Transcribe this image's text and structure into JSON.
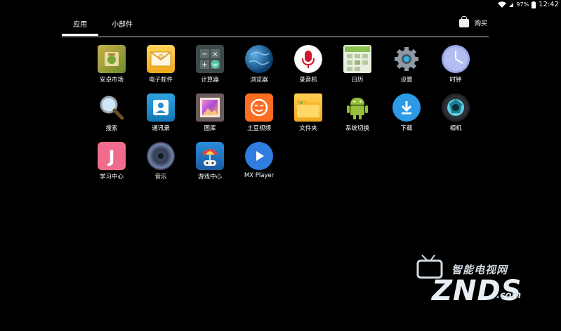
{
  "status": {
    "battery": "97%",
    "time": "12:42"
  },
  "tabs": {
    "apps": "应用",
    "widgets": "小部件",
    "buy": "购买"
  },
  "apps": [
    {
      "label": "安卓市场",
      "icon": "market-icon"
    },
    {
      "label": "电子邮件",
      "icon": "email-icon"
    },
    {
      "label": "计算器",
      "icon": "calculator-icon"
    },
    {
      "label": "浏览器",
      "icon": "browser-icon"
    },
    {
      "label": "录音机",
      "icon": "microphone-icon"
    },
    {
      "label": "日历",
      "icon": "calendar-icon"
    },
    {
      "label": "设置",
      "icon": "settings-icon"
    },
    {
      "label": "时钟",
      "icon": "clock-icon"
    },
    {
      "label": "搜索",
      "icon": "search-icon"
    },
    {
      "label": "通讯录",
      "icon": "contacts-icon"
    },
    {
      "label": "图库",
      "icon": "gallery-icon"
    },
    {
      "label": "土豆视频",
      "icon": "tudou-icon"
    },
    {
      "label": "文件夹",
      "icon": "folder-icon"
    },
    {
      "label": "系统切换",
      "icon": "android-icon"
    },
    {
      "label": "下载",
      "icon": "download-icon"
    },
    {
      "label": "相机",
      "icon": "camera-icon"
    },
    {
      "label": "学习中心",
      "icon": "learning-icon"
    },
    {
      "label": "音乐",
      "icon": "music-icon"
    },
    {
      "label": "游戏中心",
      "icon": "game-icon"
    },
    {
      "label": "MX Player",
      "icon": "play-icon"
    }
  ],
  "watermark": {
    "top": "智能电视网",
    "main": "ZNDS",
    "suffix": ".com"
  }
}
